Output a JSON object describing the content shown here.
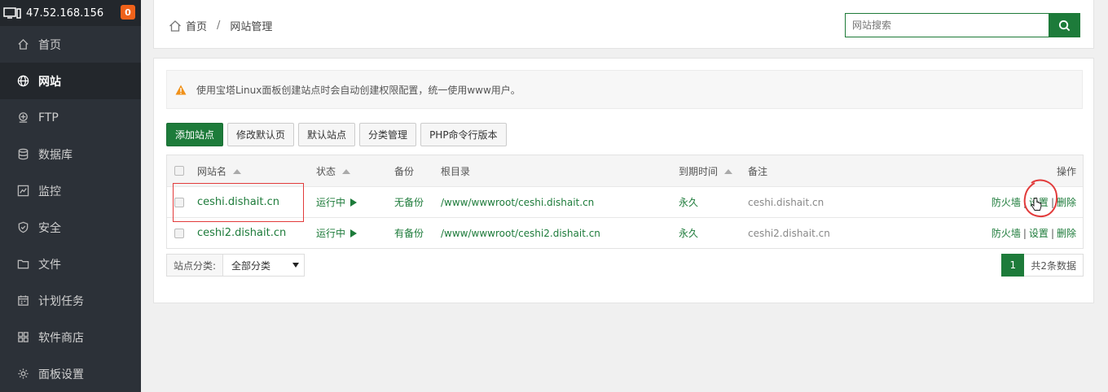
{
  "sidebar": {
    "ip": "47.52.168.156",
    "badge": "0",
    "items": [
      {
        "label": "首页",
        "icon": "home-icon"
      },
      {
        "label": "网站",
        "icon": "globe-icon",
        "active": true
      },
      {
        "label": "FTP",
        "icon": "ftp-icon"
      },
      {
        "label": "数据库",
        "icon": "database-icon"
      },
      {
        "label": "监控",
        "icon": "monitor-chart-icon"
      },
      {
        "label": "安全",
        "icon": "shield-icon"
      },
      {
        "label": "文件",
        "icon": "folder-icon"
      },
      {
        "label": "计划任务",
        "icon": "calendar-icon"
      },
      {
        "label": "软件商店",
        "icon": "grid-icon"
      },
      {
        "label": "面板设置",
        "icon": "gear-icon"
      }
    ]
  },
  "breadcrumb": {
    "home": "首页",
    "separator": "/",
    "current": "网站管理"
  },
  "search": {
    "placeholder": "网站搜索"
  },
  "alert": {
    "text": "使用宝塔Linux面板创建站点时会自动创建权限配置，统一使用www用户。"
  },
  "toolbar": {
    "add_site": "添加站点",
    "edit_default_page": "修改默认页",
    "default_site": "默认站点",
    "category_manage": "分类管理",
    "php_cli_version": "PHP命令行版本"
  },
  "table": {
    "headers": {
      "name": "网站名",
      "status": "状态",
      "backup": "备份",
      "root": "根目录",
      "expire": "到期时间",
      "note": "备注",
      "ops": "操作"
    },
    "rows": [
      {
        "name": "ceshi.dishait.cn",
        "status": "运行中",
        "backup": "无备份",
        "root": "/www/wwwroot/ceshi.dishait.cn",
        "expire": "永久",
        "note": "ceshi.dishait.cn",
        "op_firewall": "防火墙",
        "op_settings": "设置",
        "op_delete": "删除"
      },
      {
        "name": "ceshi2.dishait.cn",
        "status": "运行中",
        "backup": "有备份",
        "root": "/www/wwwroot/ceshi2.dishait.cn",
        "expire": "永久",
        "note": "ceshi2.dishait.cn",
        "op_firewall": "防火墙",
        "op_settings": "设置",
        "op_delete": "删除"
      }
    ]
  },
  "footer": {
    "category_label": "站点分类:",
    "category_value": "全部分类",
    "current_page": "1",
    "total": "共2条数据"
  },
  "colors": {
    "brand_green": "#1d7b3a",
    "sidebar_bg": "#2c3138",
    "badge_orange": "#f0621a",
    "annotation_red": "#e23b3b"
  }
}
